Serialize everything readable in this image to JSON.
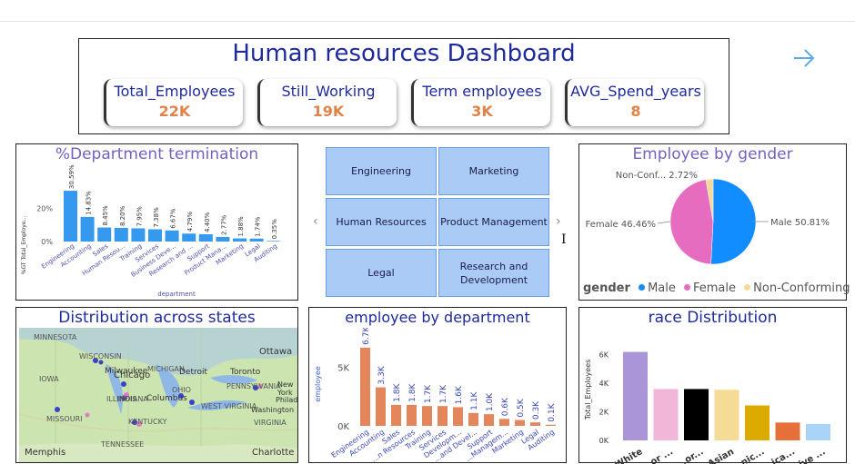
{
  "dashboard": {
    "title": "Human resources Dashboard"
  },
  "kpis": [
    {
      "label": "Total_Employees",
      "value": "22K"
    },
    {
      "label": "Still_Working",
      "value": "19K"
    },
    {
      "label": "Term employees",
      "value": "3K"
    },
    {
      "label": "AVG_Spend_years",
      "value": "8"
    }
  ],
  "dept_termination": {
    "title": "%Department termination",
    "chart_data": {
      "type": "bar",
      "title": "%Department termination",
      "xlabel": "department",
      "ylabel": "%GT Total_Employe...",
      "categories": [
        "Engineering",
        "Accounting",
        "Sales",
        "Human Resou...",
        "Training",
        "Services",
        "Business Deve...",
        "Research and ...",
        "Support",
        "Product Mana...",
        "Marketing",
        "Legal",
        "Auditing"
      ],
      "values": [
        30.59,
        14.83,
        8.45,
        8.2,
        7.95,
        7.38,
        6.67,
        4.79,
        4.4,
        2.77,
        1.88,
        1.74,
        0.35
      ],
      "data_labels": [
        "30.59%",
        "14.83%",
        "8.45%",
        "8.20%",
        "7.95%",
        "7.38%",
        "6.67%",
        "4.79%",
        "4.40%",
        "2.77%",
        "1.88%",
        "1.74%",
        "0.35%"
      ],
      "yticks": [
        "0%",
        "20%"
      ],
      "ylim": [
        0,
        35
      ]
    }
  },
  "slicer": {
    "items": [
      "Engineering",
      "Marketing",
      "Human Resources",
      "Product Management",
      "Legal",
      "Research and Development"
    ],
    "prev": "‹",
    "next": "›"
  },
  "gender": {
    "title": "Employee by gender",
    "chart_data": {
      "type": "pie",
      "title": "Employee by gender",
      "categories": [
        "Male",
        "Female",
        "Non-Conforming"
      ],
      "values": [
        50.81,
        46.46,
        2.72
      ],
      "colors": [
        "#118dff",
        "#e66cc0",
        "#f5d99a"
      ],
      "slice_labels": [
        "Male 50.81%",
        "Female 46.46%",
        "Non-Conf... 2.72%"
      ]
    },
    "legend_title": "gender",
    "legend_items": [
      "Male",
      "Female",
      "Non-Conforming"
    ]
  },
  "states_map": {
    "title": "Distribution across states",
    "labels": [
      "Ottawa",
      "MINNESOTA",
      "WISCONSIN",
      "Milwaukee",
      "Chicago",
      "MICHIGAN",
      "Detroit",
      "Toronto",
      "ILLINOIS",
      "INDIANA",
      "Columbus",
      "OHIO",
      "PENNSYLVANIA",
      "IOWA",
      "MISSOURI",
      "KENTUCKY",
      "WEST VIRGINIA",
      "VIRGINIA",
      "Philadelphia",
      "Washington",
      "New York",
      "TENNESSEE",
      "Memphis",
      "Charlotte"
    ]
  },
  "emp_by_dept": {
    "title": "employee by department",
    "chart_data": {
      "type": "bar",
      "title": "employee by department",
      "ylabel": "employee",
      "categories": [
        "Engineering",
        "Accounting",
        "Sales",
        "...n Resources",
        "Training",
        "Services",
        "Developm...",
        "...and Devel...",
        "Support",
        "...Managem...",
        "Marketing",
        "Legal",
        "Auditing"
      ],
      "values": [
        6700,
        3300,
        1800,
        1800,
        1700,
        1700,
        1600,
        1100,
        1000,
        600,
        500,
        300,
        100
      ],
      "data_labels": [
        "6.7K",
        "3.3K",
        "1.8K",
        "1.8K",
        "1.7K",
        "1.7K",
        "1.6K",
        "1.1K",
        "1.0K",
        "0.6K",
        "0.5K",
        "0.3K",
        "0.1K"
      ],
      "yticks": [
        "0K",
        "5K"
      ],
      "ylim": [
        0,
        7000
      ]
    }
  },
  "race": {
    "title": "race Distribution",
    "chart_data": {
      "type": "bar",
      "title": "race Distribution",
      "ylabel": "Total_Employees",
      "categories": [
        "White",
        "...or ...",
        "...or...",
        "Asian",
        "...nic...",
        "...ica...",
        "...ive ..."
      ],
      "values": [
        6200,
        3600,
        3600,
        3550,
        2450,
        1250,
        1150
      ],
      "colors": [
        "#a995d8",
        "#f2b6d9",
        "#000000",
        "#f4dc97",
        "#ddaa00",
        "#e5703a",
        "#a8d4f7"
      ],
      "yticks": [
        "0K",
        "2K",
        "4K",
        "6K"
      ],
      "ylim": [
        0,
        7000
      ]
    }
  },
  "icons": {
    "next_page": "arrow-right-icon",
    "text_cursor": "i-beam-cursor-icon"
  }
}
